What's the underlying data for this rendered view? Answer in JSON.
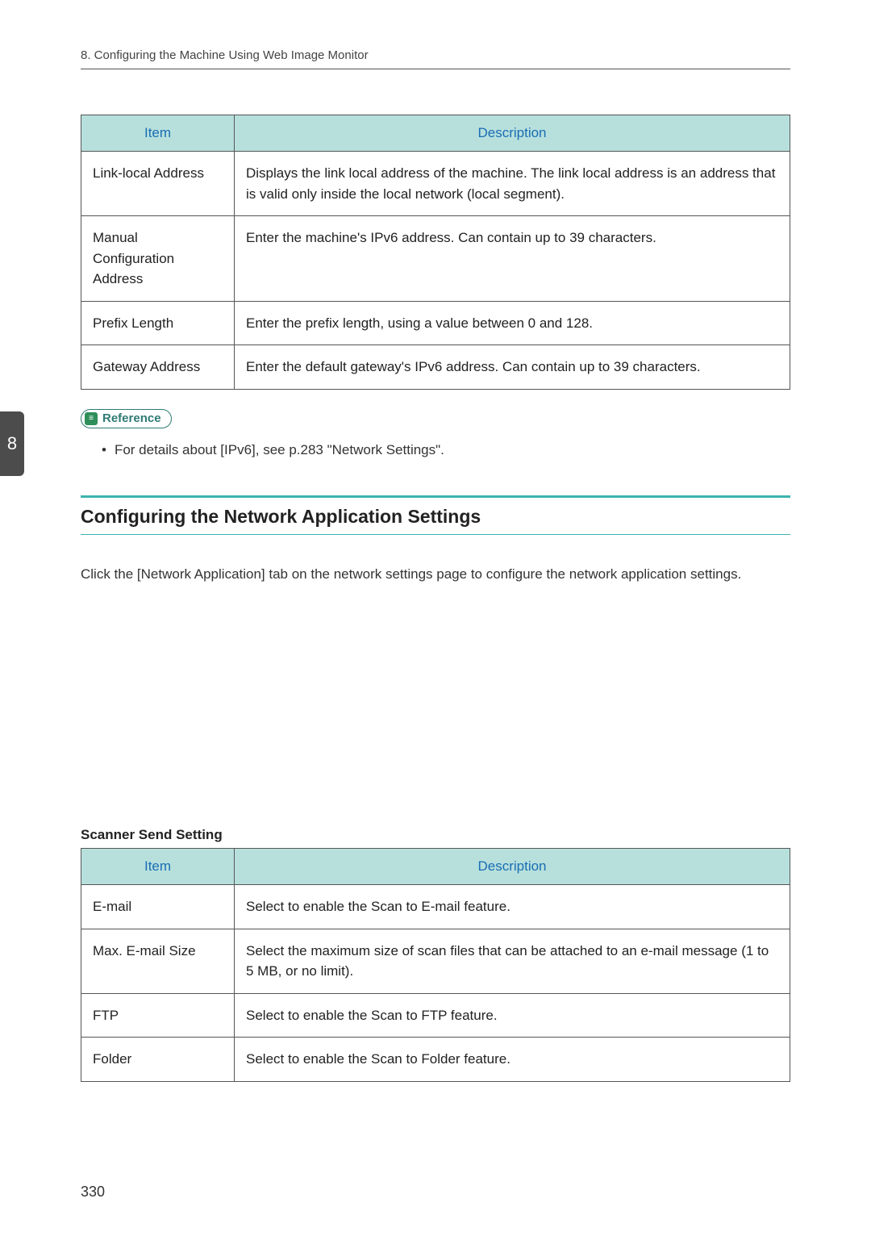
{
  "chapter_header": "8. Configuring the Machine Using Web Image Monitor",
  "side_tab": "8",
  "table1": {
    "headers": {
      "item": "Item",
      "desc": "Description"
    },
    "rows": [
      {
        "item": "Link-local Address",
        "desc": "Displays the link local address of the machine. The link local address is an address that is valid only inside the local network (local segment)."
      },
      {
        "item": "Manual Configuration Address",
        "desc": "Enter the machine's IPv6 address. Can contain up to 39 characters."
      },
      {
        "item": "Prefix Length",
        "desc": "Enter the prefix length, using a value between 0 and 128."
      },
      {
        "item": "Gateway Address",
        "desc": "Enter the default gateway's IPv6 address. Can contain up to 39 characters."
      }
    ]
  },
  "reference": {
    "label": "Reference",
    "body": "For details about [IPv6], see p.283 \"Network Settings\"."
  },
  "section_heading": "Configuring the Network Application Settings",
  "body_text": "Click the [Network Application] tab on the network settings page to configure the network application settings.",
  "subheading": "Scanner Send Setting",
  "table2": {
    "headers": {
      "item": "Item",
      "desc": "Description"
    },
    "rows": [
      {
        "item": "E-mail",
        "desc": "Select to enable the Scan to E-mail feature."
      },
      {
        "item": "Max. E-mail Size",
        "desc": "Select the maximum size of scan files that can be attached to an e-mail message (1 to 5 MB, or no limit)."
      },
      {
        "item": "FTP",
        "desc": "Select to enable the Scan to FTP feature."
      },
      {
        "item": "Folder",
        "desc": "Select to enable the Scan to Folder feature."
      }
    ]
  },
  "page_number": "330"
}
